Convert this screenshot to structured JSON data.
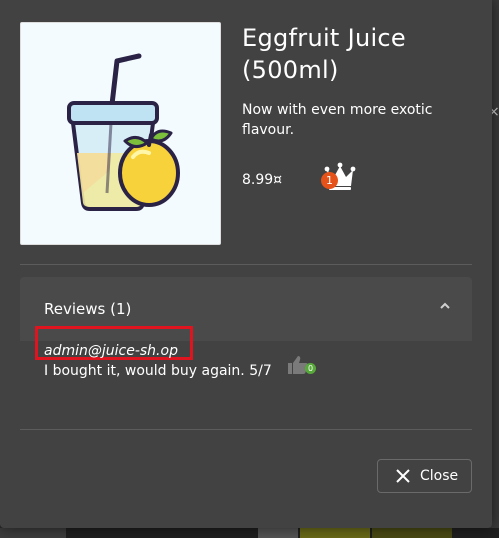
{
  "product": {
    "title": "Eggfruit Juice (500ml)",
    "description": "Now with even more exotic flavour.",
    "price": "8.99¤",
    "crown_badge": "1",
    "image_icon": "juice-cup-with-eggfruit-icon"
  },
  "reviews": {
    "header": "Reviews (1)",
    "items": [
      {
        "author": "admin@juice-sh.op",
        "text": "I bought it, would buy again. 5/7",
        "likes": "0"
      }
    ]
  },
  "actions": {
    "close_label": "Close"
  },
  "colors": {
    "dialog_bg": "#424242",
    "highlight_box": "#e0141e",
    "badge_orange": "#e5531a",
    "like_badge_green": "#58a93b"
  }
}
